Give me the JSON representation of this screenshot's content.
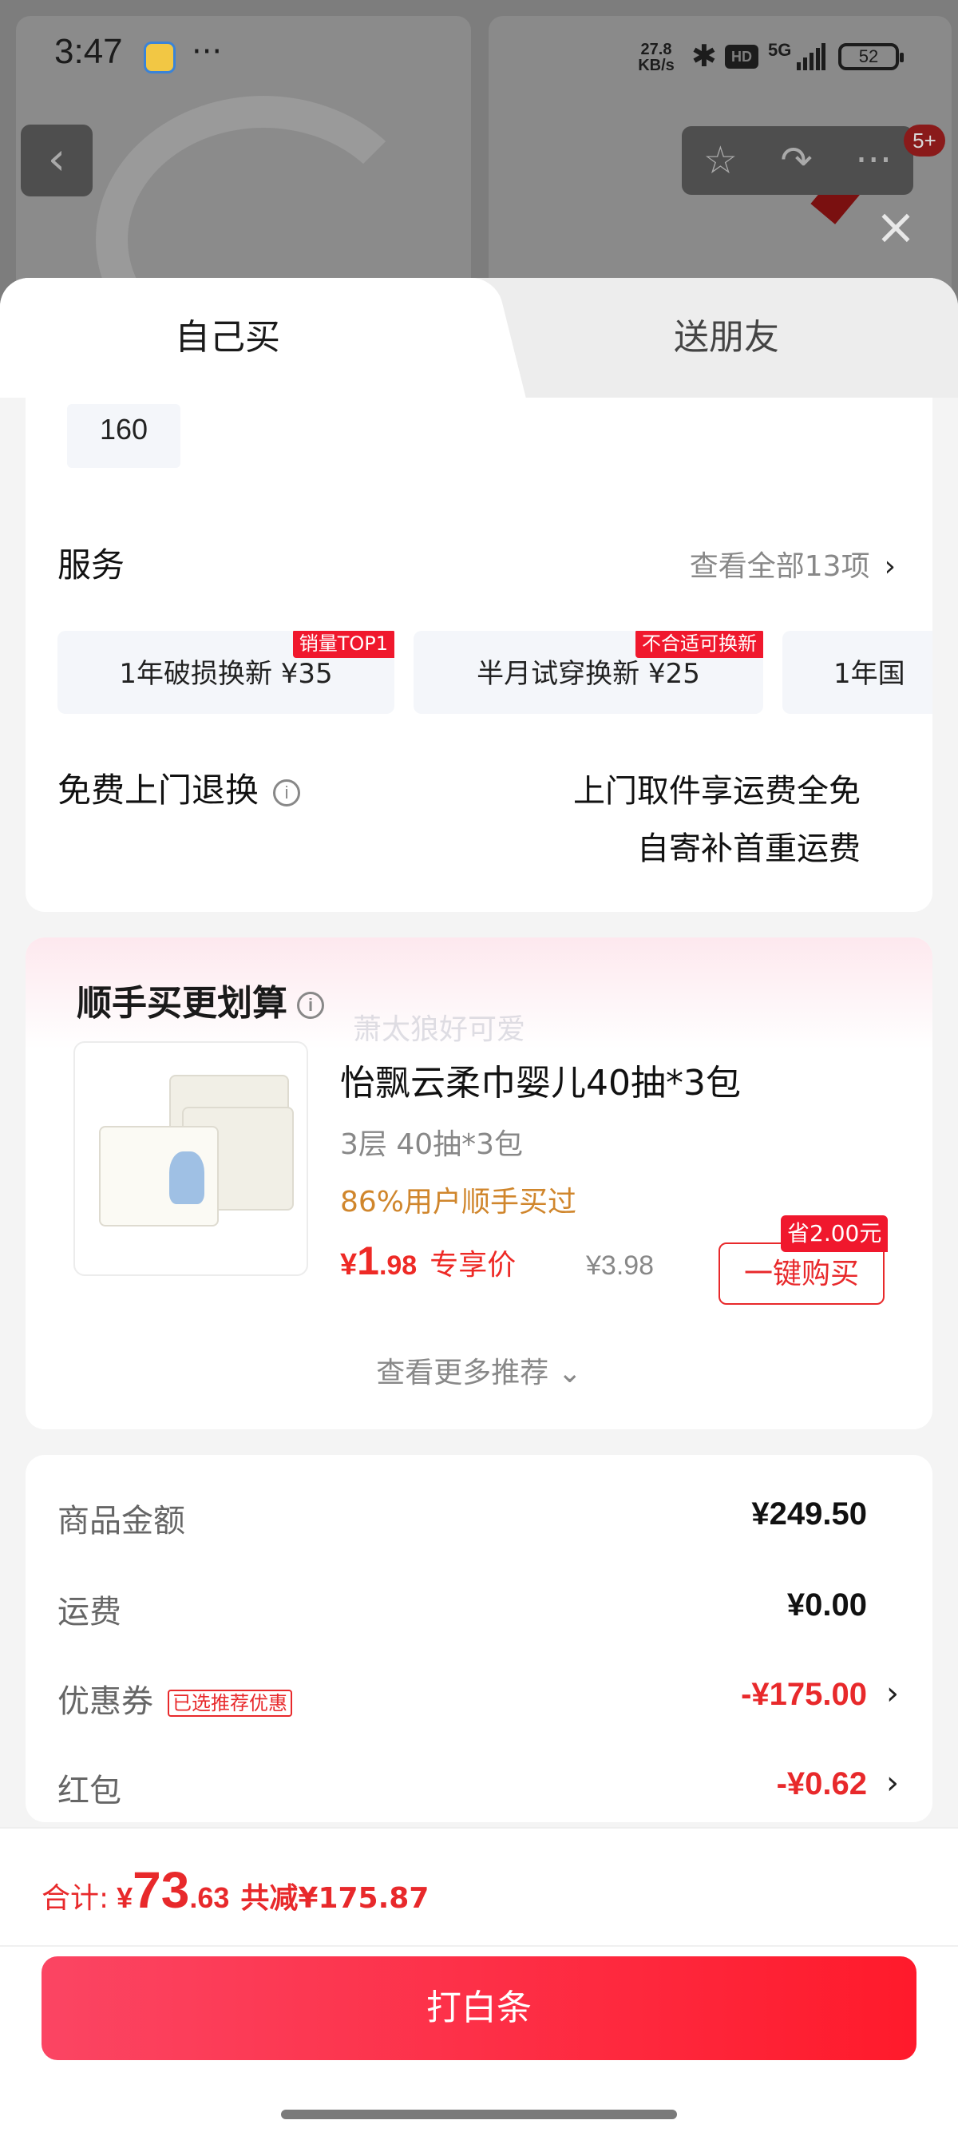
{
  "status_bar": {
    "time": "3:47",
    "more": "···",
    "net_speed_value": "27.8",
    "net_speed_unit": "KB/s",
    "bluetooth": "✱",
    "hd": "HD",
    "network": "5G",
    "battery": "52"
  },
  "nav": {
    "back": "‹",
    "favorite": "☆",
    "share": "↷",
    "more": "···",
    "badge": "5+",
    "close": "×"
  },
  "tabs": {
    "self": "自己买",
    "friend": "送朋友"
  },
  "spec": {
    "size_value": "160"
  },
  "services": {
    "title": "服务",
    "view_all": "查看全部13项",
    "chevron": "›",
    "items": [
      {
        "label": "1年破损换新  ¥35",
        "tag": "销量TOP1"
      },
      {
        "label": "半月试穿换新  ¥25",
        "tag": "不合适可换新"
      },
      {
        "label": "1年国",
        "tag": ""
      }
    ],
    "free_return_title": "免费上门退换",
    "info": "i",
    "free_line1": "上门取件享运费全免",
    "free_line2": "自寄补首重运费"
  },
  "recommend": {
    "title": "顺手买更划算",
    "info": "i",
    "watermark": "萧太狼好可爱",
    "product_name": "怡飘云柔巾婴儿40抽*3包",
    "spec": "3层 40抽*3包",
    "bought": "86%用户顺手买过",
    "price_yen": "¥",
    "price_int": "1",
    "price_dec": ".98",
    "price_label": "专享价",
    "original_price": "¥3.98",
    "buy_button": "一键购买",
    "save_tag": "省2.00元",
    "more": "查看更多推荐 ⌄"
  },
  "price_detail": {
    "goods_amount_label": "商品金额",
    "goods_amount": "¥249.50",
    "shipping_label": "运费",
    "shipping": "¥0.00",
    "coupon_label": "优惠券",
    "coupon_tag": "已选推荐优惠",
    "coupon": "-¥175.00",
    "redpacket_label": "红包",
    "redpacket": "-¥0.62",
    "chevron": "›"
  },
  "bottom": {
    "total_label": "合计:",
    "total_yen": "¥",
    "total_int": "73",
    "total_dec": ".63",
    "saved": "共减¥175.87",
    "pay_button": "打白条"
  },
  "colors": {
    "accent_red": "#e8292b",
    "pay_gradient_start": "#fb4563",
    "pay_gradient_end": "#ff1a2b",
    "bought_orange": "#d0862c"
  }
}
